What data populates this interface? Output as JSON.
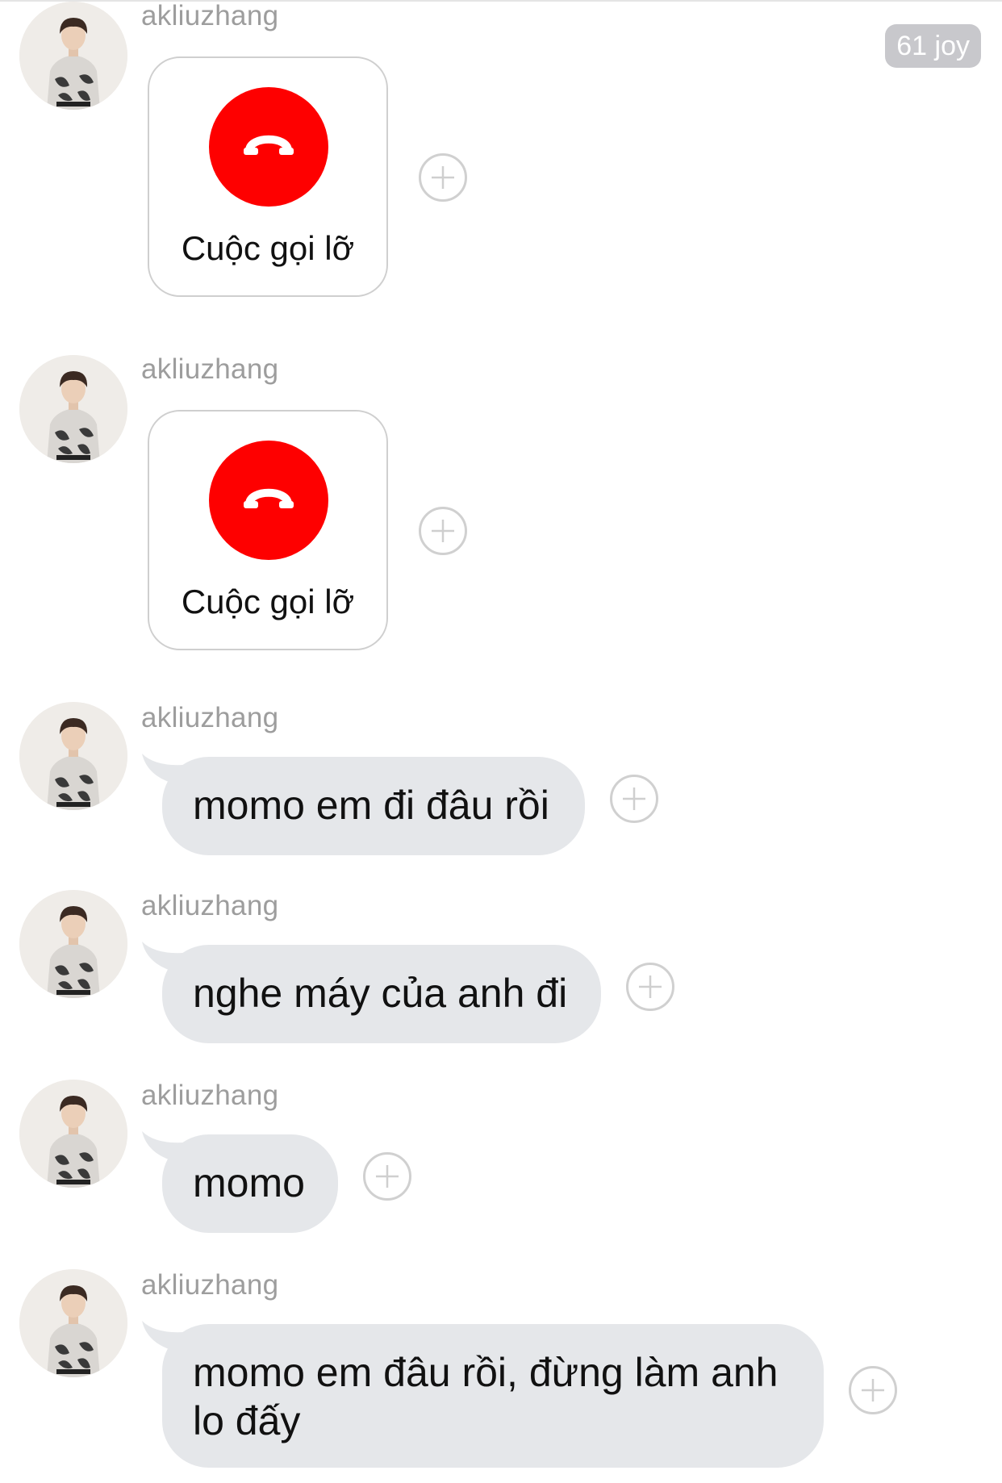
{
  "header": {
    "counter_badge": "61 joy"
  },
  "contact": {
    "name": "akliuzhang"
  },
  "colors": {
    "missed_call_red": "#fe0000",
    "bubble_gray": "#e5e7ea",
    "sender_gray": "#9d9d9d"
  },
  "messages": [
    {
      "type": "missed-call",
      "sender": "akliuzhang",
      "text": "Cuộc gọi lỡ",
      "icon": "hangup-phone-icon"
    },
    {
      "type": "missed-call",
      "sender": "akliuzhang",
      "text": "Cuộc gọi lỡ",
      "icon": "hangup-phone-icon"
    },
    {
      "type": "text",
      "sender": "akliuzhang",
      "text": "momo em đi đâu rồi"
    },
    {
      "type": "text",
      "sender": "akliuzhang",
      "text": "nghe máy của anh đi"
    },
    {
      "type": "text",
      "sender": "akliuzhang",
      "text": "momo"
    },
    {
      "type": "text",
      "sender": "akliuzhang",
      "text": "momo em đâu rồi, đừng làm anh lo đấy"
    }
  ],
  "icons": {
    "add_reaction": "plus-circle-icon",
    "missed_call": "hangup-phone-icon"
  }
}
